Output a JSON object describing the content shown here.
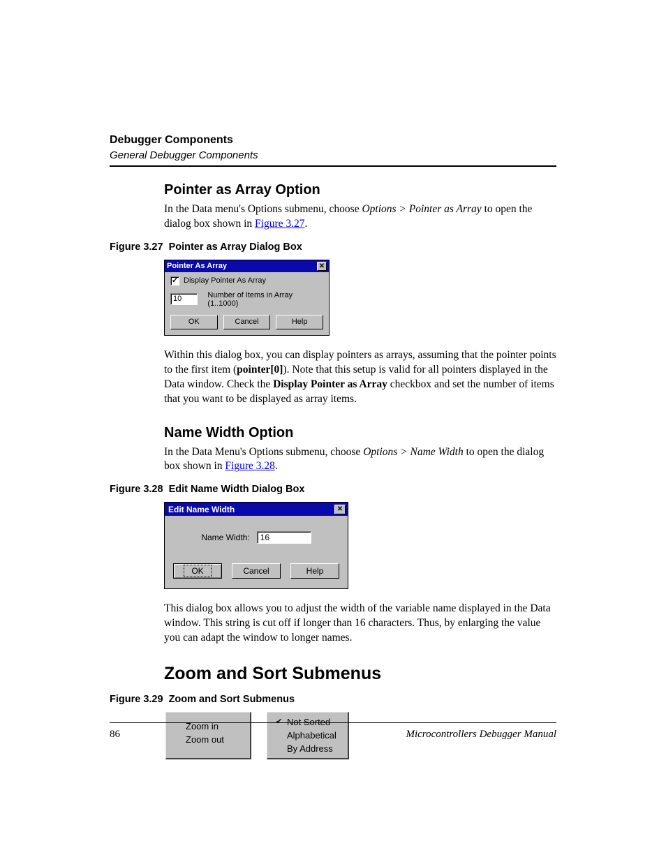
{
  "header": {
    "title": "Debugger Components",
    "subtitle": "General Debugger Components"
  },
  "section1": {
    "heading": "Pointer as Array Option",
    "para_a": "In the Data menu's Options submenu, choose ",
    "para_b_italic": "Options > Pointer as Array",
    "para_c": " to open the dialog box shown in ",
    "para_link": "Figure 3.27",
    "para_d": ".",
    "fig_num": "Figure 3.27",
    "fig_title": "Pointer as Array Dialog Box",
    "dialog": {
      "title": "Pointer As Array",
      "checkbox_label": "Display Pointer As Array",
      "input_value": "10",
      "input_label": "Number of Items in Array (1..1000)",
      "ok": "OK",
      "cancel": "Cancel",
      "help": "Help"
    },
    "after_a": "Within this dialog box, you can display pointers as arrays, assuming that the pointer points to the first item (",
    "after_b_bold": "pointer[0]",
    "after_c": "). Note that this setup is valid for all pointers displayed in the Data window. Check the ",
    "after_d_bold": "Display Pointer as Array",
    "after_e": " checkbox and set the number of items that you want to be displayed as array items."
  },
  "section2": {
    "heading": "Name Width Option",
    "para_a": "In the Data Menu's Options submenu, choose ",
    "para_b_italic": "Options > Name Width",
    "para_c": " to open the dialog box shown in ",
    "para_link": "Figure 3.28",
    "para_d": ".",
    "fig_num": "Figure 3.28",
    "fig_title": "Edit Name Width Dialog Box",
    "dialog": {
      "title": "Edit Name Width",
      "label": "Name Width:",
      "value": "16",
      "ok": "OK",
      "cancel": "Cancel",
      "help": "Help"
    },
    "after": "This dialog box allows you to adjust the width of the variable name displayed in the Data window. This string is cut off if longer than 16 characters. Thus, by enlarging the value you can adapt the window to longer names."
  },
  "section3": {
    "heading": "Zoom and Sort Submenus",
    "fig_num": "Figure 3.29",
    "fig_title": "Zoom and Sort Submenus",
    "zoom_menu": [
      "Zoom in",
      "Zoom out"
    ],
    "sort_menu": [
      "Not Sorted",
      "Alphabetical",
      "By Address"
    ]
  },
  "footer": {
    "page": "86",
    "manual": "Microcontrollers Debugger Manual"
  }
}
